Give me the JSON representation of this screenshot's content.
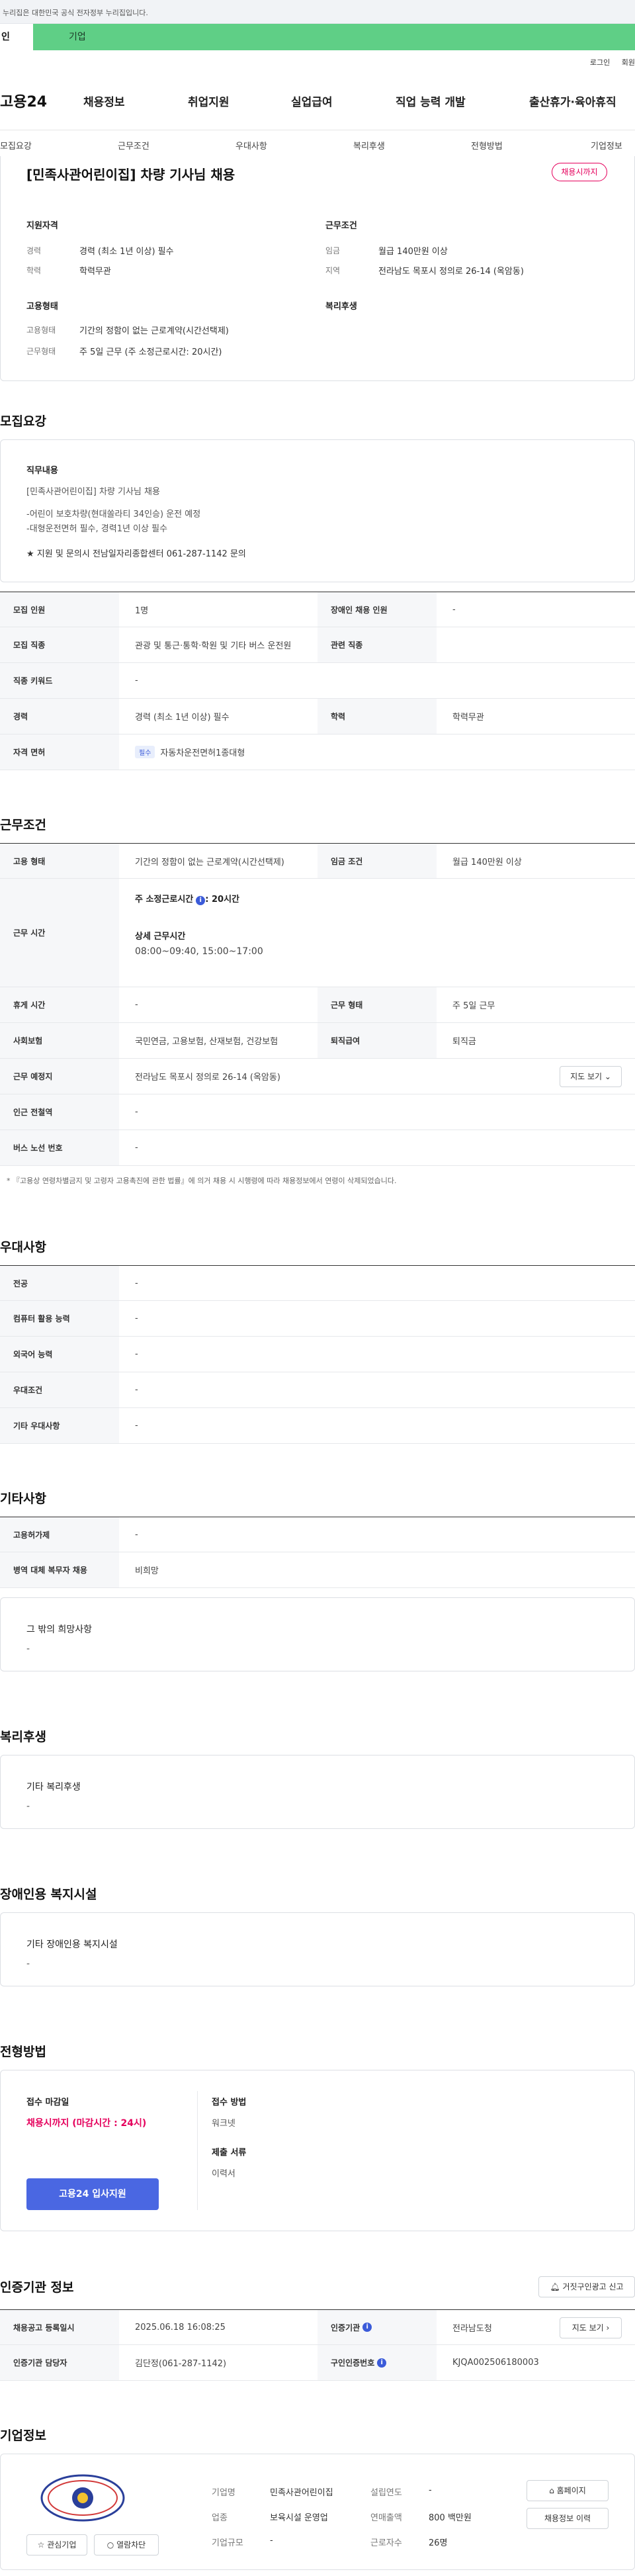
{
  "gov_banner": {
    "text": "누리집은 대한민국 공식 전자정부 누리집입니다."
  },
  "user_tabs": [
    {
      "label": "인"
    },
    {
      "label": "기업"
    }
  ],
  "util_links": [
    {
      "label": "로그인"
    },
    {
      "label": "회원"
    }
  ],
  "logo": "고용24",
  "gnb": [
    {
      "label": "채용정보"
    },
    {
      "label": "취업지원"
    },
    {
      "label": "실업급여"
    },
    {
      "label": "직업 능력 개발"
    },
    {
      "label": "출산휴가·육아휴직"
    }
  ],
  "subnav": [
    {
      "label": "모집요강"
    },
    {
      "label": "근무조건"
    },
    {
      "label": "우대사항"
    },
    {
      "label": "복리후생"
    },
    {
      "label": "전형방법"
    },
    {
      "label": "기업정보"
    }
  ],
  "summary": {
    "title": "[민족사관어린이집] 차량 기사님 채용",
    "badge": "채용시까지",
    "qual_head": "지원자격",
    "career_label": "경력",
    "career_value": "경력 (최소 1년 이상) 필수",
    "edu_label": "학력",
    "edu_value": "학력무관",
    "cond_head": "근무조건",
    "wage_label": "임금",
    "wage_value": "월급 140만원 이상",
    "region_label": "지역",
    "region_value": "전라남도 목포시 정의로 26-14 (옥암동)",
    "emp_head": "고용형태",
    "type_label": "고용형태",
    "type_value": "기간의 정함이 없는 근로계약(시간선택제)",
    "form_label": "근무형태",
    "form_value": "주 5일 근무 (주 소정근로시간: 20시간)",
    "welfare_head": "복리후생"
  },
  "recruit": {
    "title": "모집요강",
    "duty_label": "직무내용",
    "duty_lines": [
      "[민족사관어린이집] 차량 기사님 채용",
      "-어린이 보호차량(현대쏠라티 34인승) 운전 예정",
      "-대형운전면허 필수, 경력1년 이상 필수",
      "★ 지원 및 문의시 전남일자리종합센터 061-287-1142 문의"
    ],
    "rows": {
      "count_label": "모집 인원",
      "count_value": "1명",
      "disabled_label": "장애인 채용 인원",
      "disabled_value": "-",
      "job_label": "모집 직종",
      "job_value": "관광 및 통근·통학·학원 및 기타 버스 운전원",
      "related_label": "관련 직종",
      "related_value": "",
      "keyword_label": "직종 키워드",
      "keyword_value": "-",
      "career_label": "경력",
      "career_value": "경력 (최소 1년 이상) 필수",
      "edu_label": "학력",
      "edu_value": "학력무관",
      "license_label": "자격 면허",
      "license_tag": "필수",
      "license_value": "자동차운전면허1종대형"
    }
  },
  "work": {
    "title": "근무조건",
    "type_label": "고용 형태",
    "type_value": "기간의 정함이 없는 근로계약(시간선택제)",
    "wage_label": "임금 조건",
    "wage_value": "월급 140만원 이상",
    "hours_label": "근무 시간",
    "hours_sub1": "주 소정근로시간",
    "hours_sub1_value": ": 20시간",
    "hours_sub2": "상세 근무시간",
    "hours_sub2_value": "08:00~09:40, 15:00~17:00",
    "break_label": "휴게 시간",
    "break_value": "-",
    "form_label": "근무 형태",
    "form_value": "주 5일 근무",
    "insurance_label": "사회보험",
    "insurance_value": "국민연금, 고용보험, 산재보험, 건강보험",
    "retire_label": "퇴직급여",
    "retire_value": "퇴직금",
    "place_label": "근무 예정지",
    "place_value": "전라남도 목포시 정의로 26-14 (옥암동)",
    "map_btn": "지도 보기",
    "subway_label": "인근 전철역",
    "subway_value": "-",
    "bus_label": "버스 노선 번호",
    "bus_value": "-",
    "note": "* 『고용상 연령차별금지 및 고령자 고용촉진에 관한 법률』에 의거 채용 시 시행령에 따라 채용정보에서 연령이 삭제되었습니다."
  },
  "pref": {
    "title": "우대사항",
    "rows": [
      {
        "label": "전공",
        "value": "-"
      },
      {
        "label": "컴퓨터 활용 능력",
        "value": "-"
      },
      {
        "label": "외국어 능력",
        "value": "-"
      },
      {
        "label": "우대조건",
        "value": "-"
      },
      {
        "label": "기타 우대사항",
        "value": "-"
      }
    ]
  },
  "etc": {
    "title": "기타사항",
    "rows": [
      {
        "label": "고용허가제",
        "value": "-"
      },
      {
        "label": "병역 대체 복무자 채용",
        "value": "비희망"
      }
    ],
    "box_label": "그 밖의 희망사항",
    "box_value": "-"
  },
  "welfare": {
    "title": "복리후생",
    "box_label": "기타 복리후생",
    "box_value": "-"
  },
  "facility": {
    "title": "장애인용 복지시설",
    "box_label": "기타 장애인용 복지시설",
    "box_value": "-"
  },
  "selection": {
    "title": "전형방법",
    "deadline_label": "접수 마감일",
    "deadline_value": "채용시까지 (마감시간 : 24시)",
    "apply_btn": "고용24 입사지원",
    "method_label": "접수 방법",
    "method_value": "워크넷",
    "docs_label": "제출 서류",
    "docs_value": "이력서"
  },
  "cert": {
    "title": "인증기관 정보",
    "report_btn": "거짓구인광고 신고",
    "reg_label": "채용공고 등록일시",
    "reg_value": "2025.06.18 16:08:25",
    "agency_label": "인증기관",
    "agency_value": "전라남도청",
    "map_btn": "지도 보기",
    "manager_label": "인증기관 담당자",
    "manager_value": "김단정(061-287-1142)",
    "num_label": "구인인증번호",
    "num_value": "KJQA002506180003"
  },
  "company": {
    "title": "기업정보",
    "name_label": "기업명",
    "name_value": "민족사관어린이집",
    "founded_label": "설립연도",
    "founded_value": "-",
    "industry_label": "업종",
    "industry_value": "보육시설 운영업",
    "sales_label": "연매출액",
    "sales_value": "800 백만원",
    "size_label": "기업규모",
    "size_value": "-",
    "employees_label": "근로자수",
    "employees_value": "26명",
    "home_btn": "홈페이지",
    "history_btn": "채용정보 이력",
    "fav_btn": "관심기업",
    "block_btn": "열람차단"
  },
  "colors": {
    "accent": "#4a67e2",
    "green": "#5fcf86",
    "closed": "#e5005c"
  }
}
